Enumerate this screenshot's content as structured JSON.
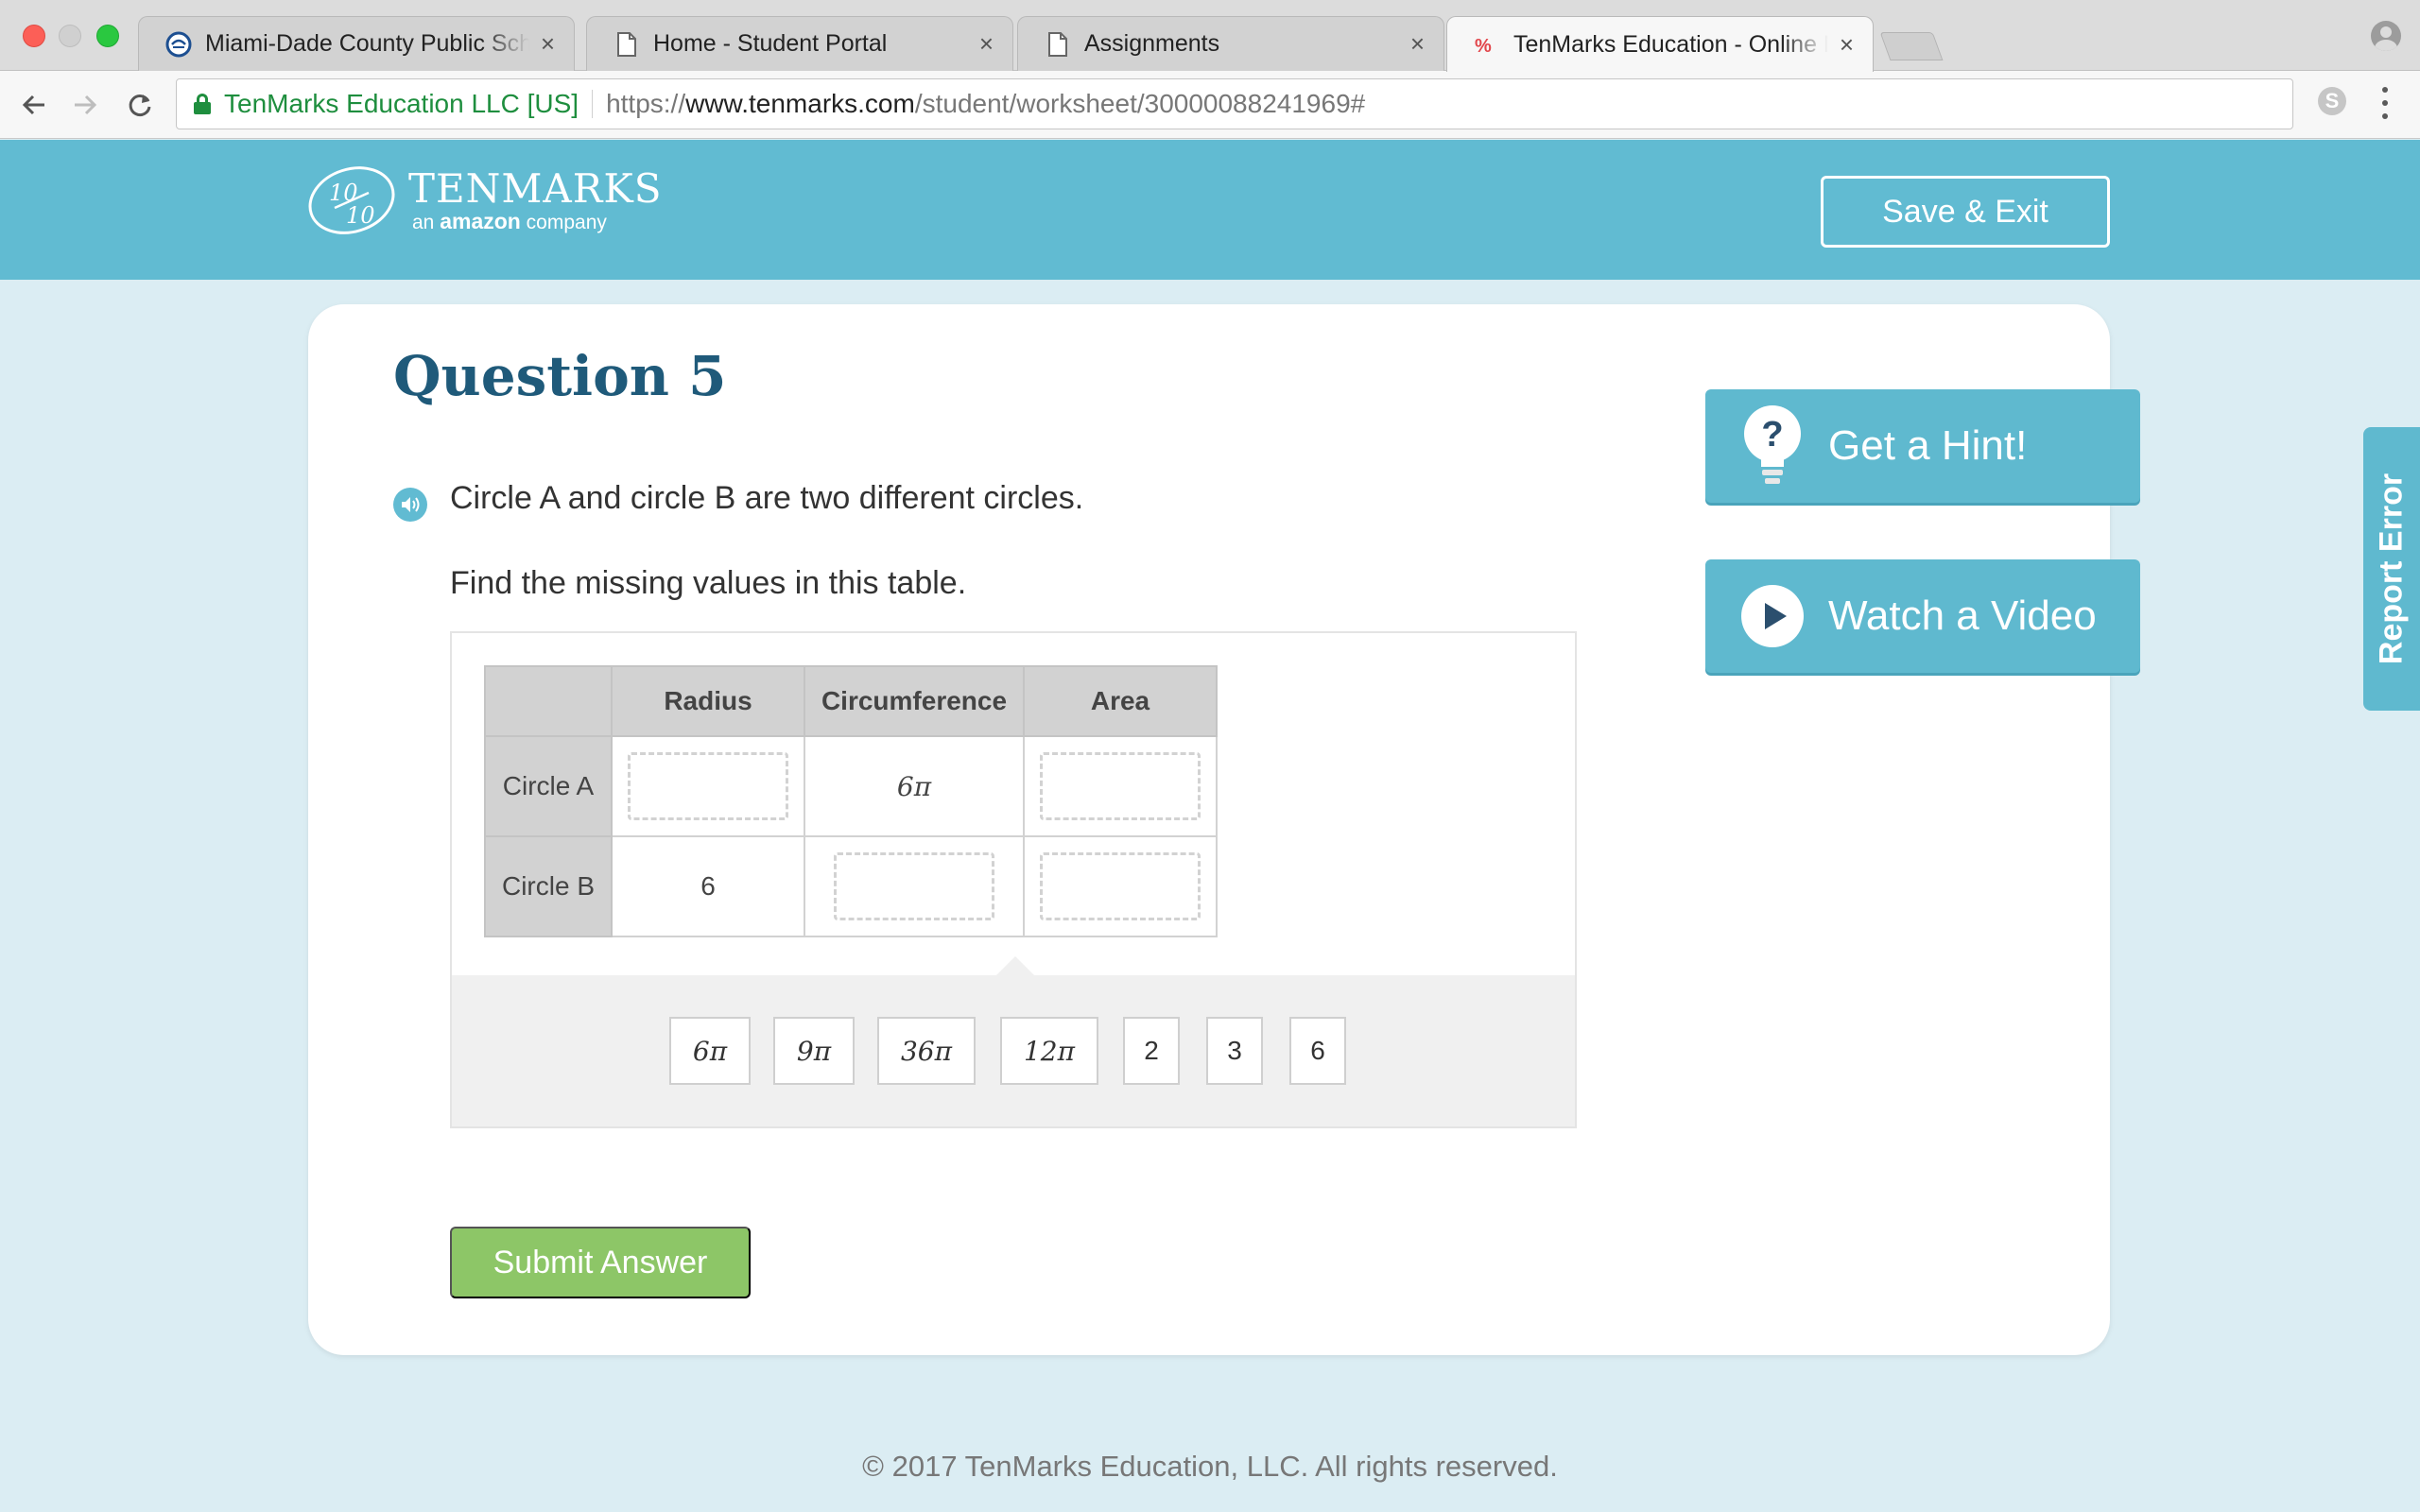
{
  "browser": {
    "tabs": [
      {
        "title": "Miami-Dade County Public Schools",
        "icon": "district-logo-icon",
        "active": false
      },
      {
        "title": "Home - Student Portal",
        "icon": "page-icon",
        "active": false
      },
      {
        "title": "Assignments",
        "icon": "page-icon",
        "active": false
      },
      {
        "title": "TenMarks Education - Online Math",
        "icon": "tenmarks-favicon-icon",
        "active": true
      }
    ],
    "close_glyph": "×",
    "site_identity": "TenMarks Education LLC [US]",
    "url": {
      "scheme": "https://",
      "host": "www.tenmarks.com",
      "path": "/student/worksheet/30000088241969#"
    },
    "extension_label": "S"
  },
  "header": {
    "brand": "TENMARKS",
    "tagline_pre": "an ",
    "tagline_bold": "amazon",
    "tagline_post": " company",
    "save_exit_label": "Save & Exit",
    "color": "#61bbd2"
  },
  "question": {
    "title": "Question 5",
    "prompt": "Circle A and circle B are two different circles.",
    "instruction": "Find the missing values in this table.",
    "table": {
      "corner": "",
      "headers": [
        "Radius",
        "Circumference",
        "Area"
      ],
      "rows": [
        {
          "label": "Circle A",
          "radius": "",
          "circumference": "6π",
          "area": ""
        },
        {
          "label": "Circle B",
          "radius": "6",
          "circumference": "",
          "area": ""
        }
      ]
    },
    "answer_tiles": [
      "6π",
      "9π",
      "36π",
      "12π",
      "2",
      "3",
      "6"
    ],
    "submit_label": "Submit Answer"
  },
  "sidebar": {
    "hint_label": "Get a Hint!",
    "video_label": "Watch a Video",
    "report_error_label": "Report Error"
  },
  "footer": {
    "copyright": "© 2017 TenMarks Education, LLC. All rights reserved."
  },
  "colors": {
    "accent": "#61bbd2",
    "title": "#1f5a7a",
    "submit": "#8dc667",
    "background": "#dbedf3"
  }
}
